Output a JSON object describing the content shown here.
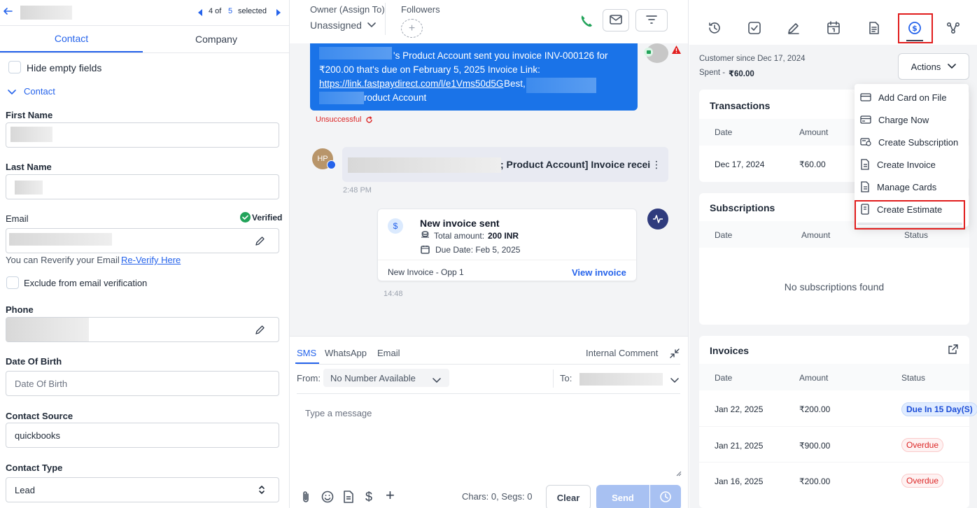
{
  "left": {
    "pager": {
      "current": "4 of",
      "total": "5",
      "suffix": "selected"
    },
    "tabs": [
      "Contact",
      "Company"
    ],
    "hide_empty_fields": "Hide empty fields",
    "section_title": "Contact",
    "fields": {
      "first_name": "First Name",
      "last_name": "Last Name",
      "email": "Email",
      "verified": "Verified",
      "reverify_text": "You can Reverify your Email",
      "reverify_link": "Re-Verify Here",
      "exclude_verification": "Exclude from email verification",
      "phone": "Phone",
      "dob": "Date Of Birth",
      "dob_placeholder": "Date Of Birth",
      "contact_source": "Contact Source",
      "contact_source_value": "quickbooks",
      "contact_type": "Contact Type",
      "contact_type_value": "Lead"
    }
  },
  "middle": {
    "owner_label": "Owner (Assign To)",
    "owner_value": "Unassigned",
    "followers_label": "Followers",
    "message1": {
      "line1": "'s Product Account sent you invoice INV-000126 for",
      "line2": "₹200.00 that's due on February 5, 2025 Invoice Link:",
      "link": "https://link.fastpaydirect.com/l/e1Vms50d5G",
      "best": " Best,",
      "line4": "roduct Account",
      "status": "Unsuccessful"
    },
    "message2": {
      "avatar": "HP",
      "text": "; Product Account] Invoice receive",
      "time": "2:48 PM"
    },
    "invoice_card": {
      "title": "New invoice sent",
      "total_label": "Total amount: ",
      "total_value": "200 INR",
      "due_label": "Due Date: Feb 5, 2025",
      "footer_left": "New Invoice - Opp 1",
      "footer_link": "View invoice",
      "time": "14:48"
    },
    "composer": {
      "tabs": [
        "SMS",
        "WhatsApp",
        "Email"
      ],
      "internal_comment": "Internal Comment",
      "from_label": "From:",
      "from_value": "No Number Available",
      "to_label": "To:",
      "placeholder": "Type a message",
      "counter": "Chars: 0, Segs: 0",
      "clear": "Clear",
      "send": "Send"
    }
  },
  "right": {
    "customer_since": "Customer since Dec 17, 2024",
    "spent_label": "Spent - ",
    "spent_value": "₹60.00",
    "actions_label": "Actions",
    "actions_menu": [
      "Add Card on File",
      "Charge Now",
      "Create Subscription",
      "Create Invoice",
      "Manage Cards",
      "Create Estimate"
    ],
    "transactions": {
      "title": "Transactions",
      "headers": [
        "Date",
        "Amount"
      ],
      "rows": [
        {
          "date": "Dec 17, 2024",
          "amount": "₹60.00"
        }
      ]
    },
    "subscriptions": {
      "title": "Subscriptions",
      "headers": [
        "Date",
        "Amount",
        "Status"
      ],
      "empty": "No subscriptions found"
    },
    "invoices": {
      "title": "Invoices",
      "headers": [
        "Date",
        "Amount",
        "Status"
      ],
      "rows": [
        {
          "date": "Jan 22, 2025",
          "amount": "₹200.00",
          "status": "Due In 15 Day(S)"
        },
        {
          "date": "Jan 21, 2025",
          "amount": "₹900.00",
          "status": "Overdue"
        },
        {
          "date": "Jan 16, 2025",
          "amount": "₹200.00",
          "status": "Overdue"
        }
      ]
    }
  },
  "colors": {
    "primary": "#2563eb",
    "bubble": "#1a73e8",
    "highlight": "#e11d1d",
    "danger": "#dc2626",
    "success": "#22a35a"
  }
}
